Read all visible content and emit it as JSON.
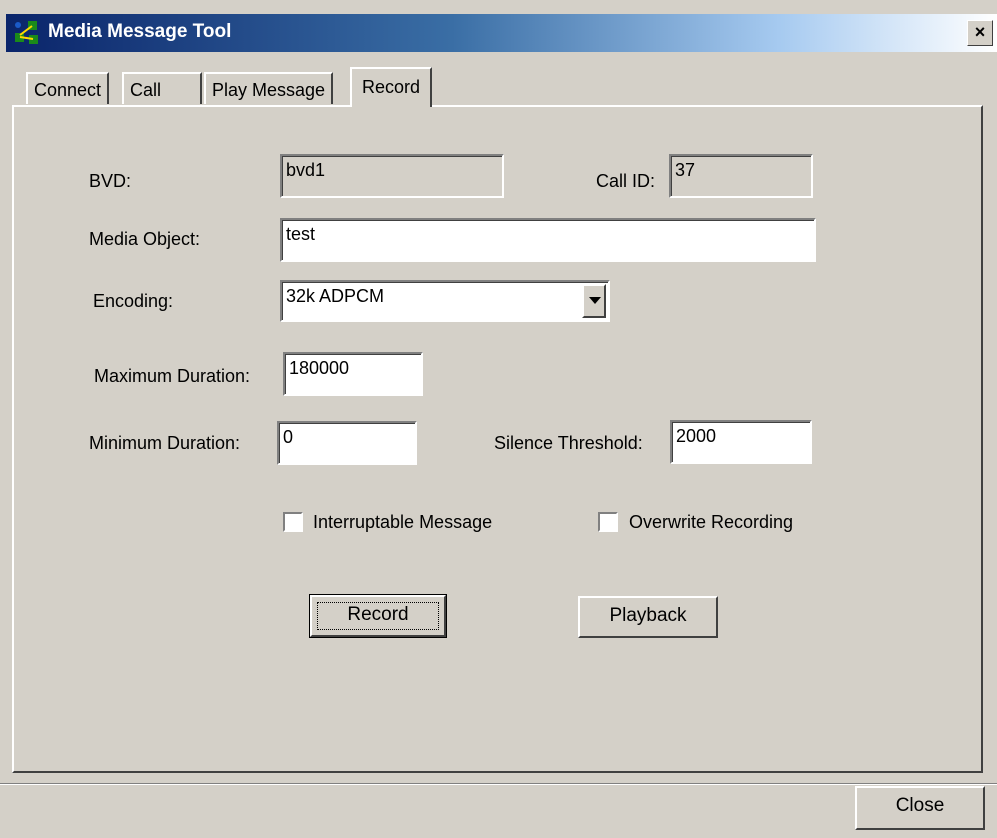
{
  "window": {
    "title": "Media Message Tool",
    "icon": "app-network-icon",
    "close_glyph": "×"
  },
  "tabs": [
    {
      "label": "Connect",
      "active": false
    },
    {
      "label": "Call",
      "active": false
    },
    {
      "label": "Play Message",
      "active": false
    },
    {
      "label": "Record",
      "active": true
    }
  ],
  "form": {
    "bvd_label": "BVD:",
    "bvd_value": "bvd1",
    "call_id_label": "Call ID:",
    "call_id_value": "37",
    "media_object_label": "Media Object:",
    "media_object_value": "test",
    "encoding_label": "Encoding:",
    "encoding_value": "32k ADPCM",
    "max_duration_label": "Maximum Duration:",
    "max_duration_value": "180000",
    "min_duration_label": "Minimum Duration:",
    "min_duration_value": "0",
    "silence_threshold_label": "Silence Threshold:",
    "silence_threshold_value": "2000",
    "interruptable_label": "Interruptable Message",
    "interruptable_checked": false,
    "overwrite_label": "Overwrite Recording",
    "overwrite_checked": false
  },
  "buttons": {
    "record_label": "Record",
    "playback_label": "Playback",
    "close_label": "Close"
  },
  "colors": {
    "face": "#d4d0c8",
    "title_start": "#0a246a",
    "title_end": "#a6caf0"
  }
}
